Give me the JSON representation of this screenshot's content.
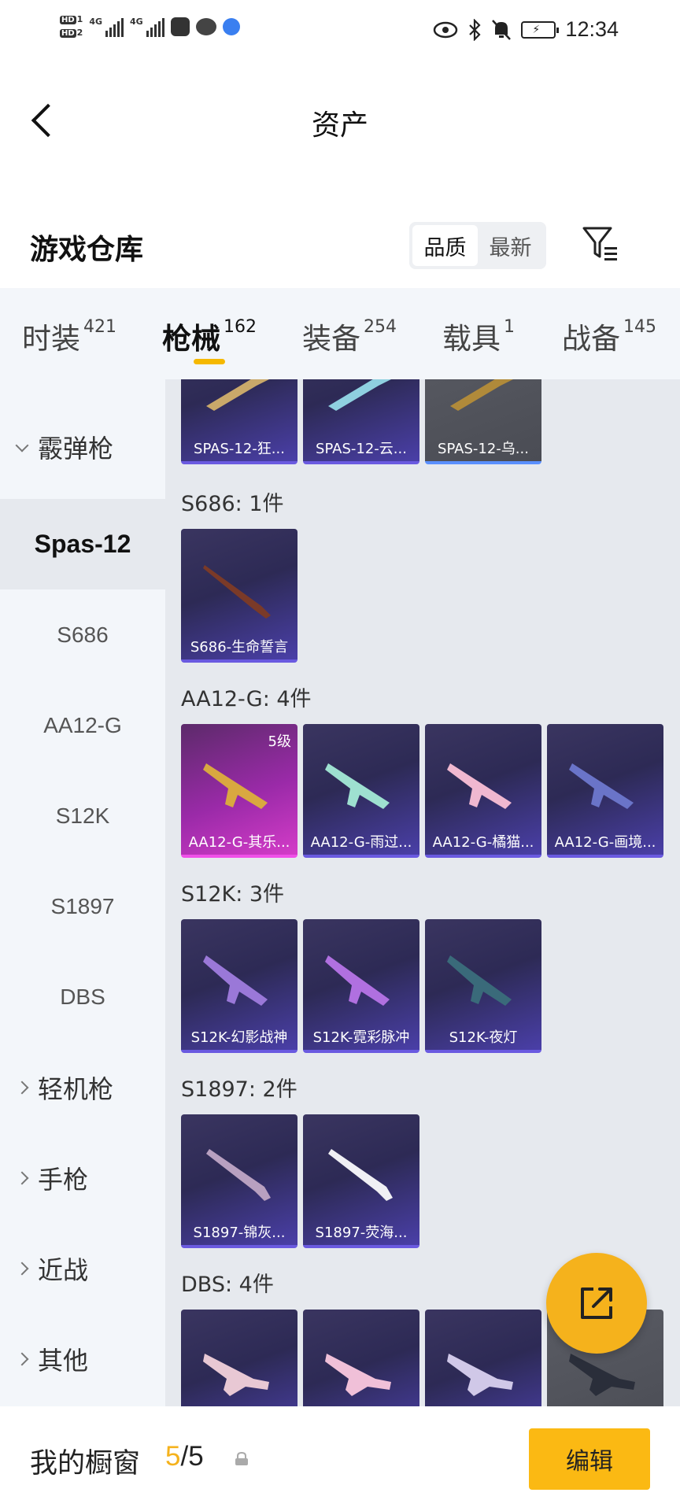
{
  "status_bar": {
    "time": "12:34",
    "hd1": "HD",
    "hd2": "HD",
    "net1": "4G",
    "net2": "4G"
  },
  "header": {
    "title": "资产"
  },
  "warehouse": {
    "title": "游戏仓库",
    "sort_options": [
      "品质",
      "最新"
    ]
  },
  "tabs": [
    {
      "label": "时装",
      "count": "421"
    },
    {
      "label": "枪械",
      "count": "162"
    },
    {
      "label": "装备",
      "count": "254"
    },
    {
      "label": "载具",
      "count": "1"
    },
    {
      "label": "战备",
      "count": "145"
    }
  ],
  "sidebar": {
    "category_shotgun": "霰弹枪",
    "subs": [
      "Spas-12",
      "S686",
      "AA12-G",
      "S12K",
      "S1897",
      "DBS"
    ],
    "categories": [
      "轻机枪",
      "手枪",
      "近战",
      "其他"
    ]
  },
  "groups": {
    "spas": {
      "items": [
        "SPAS-12-狂...",
        "SPAS-12-云...",
        "SPAS-12-乌..."
      ]
    },
    "s686": {
      "heading": "S686: 1件",
      "items": [
        "S686-生命誓言"
      ]
    },
    "aa12": {
      "heading": "AA12-G: 4件",
      "level_badge": "5级",
      "items": [
        "AA12-G-其乐...",
        "AA12-G-雨过...",
        "AA12-G-橘猫...",
        "AA12-G-画境..."
      ]
    },
    "s12k": {
      "heading": "S12K: 3件",
      "items": [
        "S12K-幻影战神",
        "S12K-霓彩脉冲",
        "S12K-夜灯"
      ]
    },
    "s1897": {
      "heading": "S1897: 2件",
      "items": [
        "S1897-锦灰...",
        "S1897-荧海..."
      ]
    },
    "dbs": {
      "heading": "DBS: 4件"
    }
  },
  "bottom": {
    "label": "我的橱窗",
    "count_current": "5",
    "count_sep": "/",
    "count_total": "5",
    "edit": "编辑"
  },
  "colors": {
    "accent": "#f5b21c",
    "card_bg": "#2d2a55",
    "card_pink": "#d43cc8"
  }
}
